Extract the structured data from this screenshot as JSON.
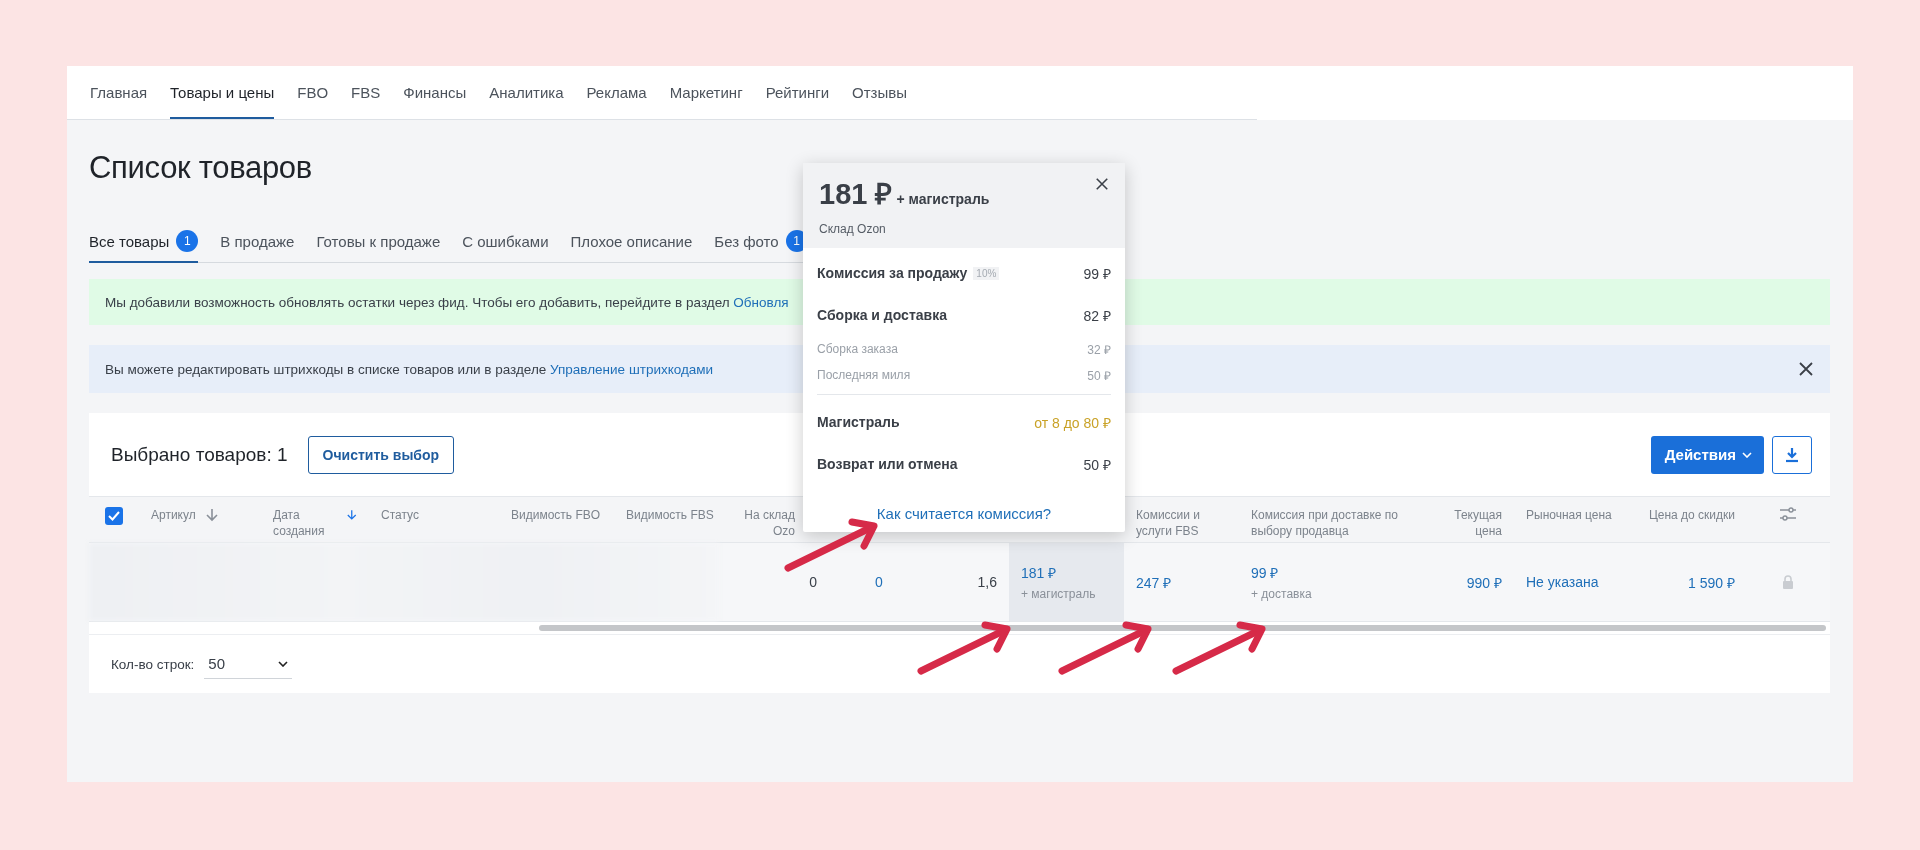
{
  "nav": {
    "items": [
      {
        "label": "Главная",
        "selected": false
      },
      {
        "label": "Товары и цены",
        "selected": true
      },
      {
        "label": "FBO",
        "selected": false
      },
      {
        "label": "FBS",
        "selected": false
      },
      {
        "label": "Финансы",
        "selected": false
      },
      {
        "label": "Аналитика",
        "selected": false
      },
      {
        "label": "Реклама",
        "selected": false
      },
      {
        "label": "Маркетинг",
        "selected": false
      },
      {
        "label": "Рейтинги",
        "selected": false
      },
      {
        "label": "Отзывы",
        "selected": false
      }
    ]
  },
  "title": "Список товаров",
  "tabs": [
    {
      "label": "Все товары",
      "badge": "1",
      "selected": true
    },
    {
      "label": "В продаже",
      "selected": false
    },
    {
      "label": "Готовы к продаже",
      "selected": false
    },
    {
      "label": "С ошибками",
      "selected": false
    },
    {
      "label": "Плохое описание",
      "selected": false
    },
    {
      "label": "Без фото",
      "badge": "1",
      "selected": false
    }
  ],
  "banners": [
    {
      "kind": "success",
      "text": "Мы добавили возможность обновлять остатки через фид. Чтобы его добавить, перейдите в раздел",
      "link": "Обновля",
      "closable": false
    },
    {
      "kind": "info",
      "text": "Вы можете редактировать штрихкоды в списке товаров или в разделе",
      "link": "Управление штрихкодами",
      "closable": true
    }
  ],
  "selection": {
    "label": "Выбрано товаров: 1",
    "clear_button": "Очистить выбор",
    "actions_button": "Действия"
  },
  "table": {
    "all_checked": true,
    "columns": [
      {
        "label": "Артикул",
        "sortable": true,
        "sorted": false
      },
      {
        "label": "Дата создания",
        "sortable": true,
        "sorted": true
      },
      {
        "label": "Статус"
      },
      {
        "label": "Видимость FBO"
      },
      {
        "label": "Видимость FBS"
      },
      {
        "label": "На склад Ozo",
        "cell": {
          "kind": "text",
          "value": "0"
        }
      },
      {
        "cell": {
          "kind": "link",
          "value": "0"
        }
      },
      {
        "cell": {
          "kind": "text",
          "value": "1,6"
        }
      },
      {
        "cell": {
          "kind": "link",
          "value": "181 ₽",
          "sub": "+ магистраль",
          "highlighted": true
        }
      },
      {
        "label": "Комиссии и услуги FBS",
        "cell": {
          "kind": "link",
          "value": "247 ₽"
        }
      },
      {
        "label": "Комиссия при доставке по выбору продавца",
        "cell": {
          "kind": "link",
          "value": "99 ₽",
          "sub": "+ доставка"
        }
      },
      {
        "label": "Текущая цена",
        "cell": {
          "kind": "link",
          "value": "990 ₽"
        }
      },
      {
        "label": "Рыночная цена",
        "cell": {
          "kind": "link",
          "value": "Не указана"
        }
      },
      {
        "label": "Цена до скидки",
        "cell": {
          "kind": "link",
          "value": "1 590 ₽"
        }
      },
      {
        "kind": "settings",
        "cell": {
          "kind": "lock"
        }
      }
    ]
  },
  "pager": {
    "label": "Кол-во строк:",
    "value": "50"
  },
  "popover": {
    "price": "181 ₽",
    "price_note": "+ магистраль",
    "warehouse": "Склад Ozon",
    "lines": [
      {
        "kind": "main",
        "label": "Комиссия за продажу",
        "tag": "10%",
        "amount": "99 ₽"
      },
      {
        "kind": "main",
        "label": "Сборка и доставка",
        "amount": "82 ₽"
      },
      {
        "kind": "sub",
        "label": "Сборка заказа",
        "amount": "32 ₽"
      },
      {
        "kind": "sub",
        "label": "Последняя миля",
        "amount": "50 ₽"
      },
      {
        "kind": "divider"
      },
      {
        "kind": "main",
        "label": "Магистраль",
        "amount": "от 8 до 80 ₽",
        "accent": true
      },
      {
        "kind": "main",
        "label": "Возврат или отмена",
        "amount": "50 ₽"
      }
    ],
    "link": "Как считается комиссия?"
  }
}
